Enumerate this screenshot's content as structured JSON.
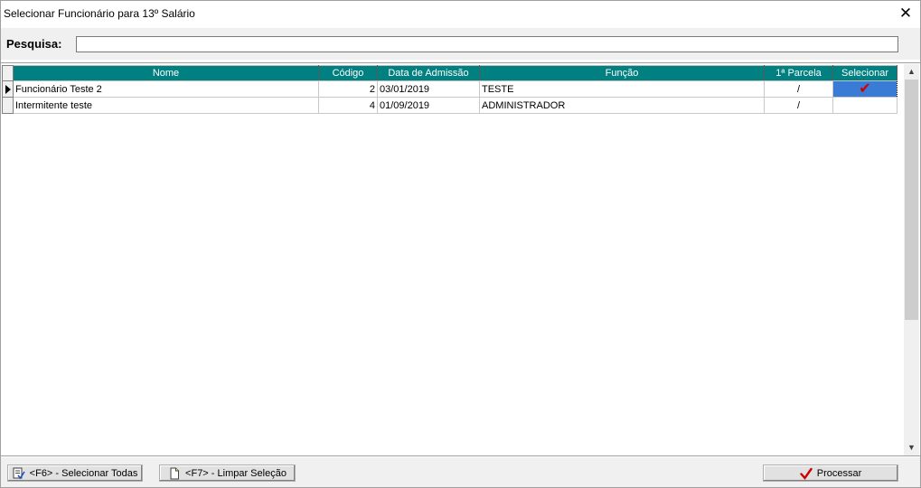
{
  "window": {
    "title": "Selecionar Funcionário para 13º Salário",
    "close_glyph": "✕"
  },
  "search": {
    "label": "Pesquisa:",
    "value": "",
    "placeholder": ""
  },
  "grid": {
    "columns": [
      "Nome",
      "Código",
      "Data de Admissão",
      "Função",
      "1ª Parcela",
      "Selecionar"
    ],
    "rows": [
      {
        "nome": "Funcionário Teste 2",
        "codigo": "2",
        "data_admissao": "03/01/2019",
        "funcao": "TESTE",
        "parcela": "/",
        "selecionar": "✔",
        "current": true,
        "selected": true
      },
      {
        "nome": "Intermitente teste",
        "codigo": "4",
        "data_admissao": "01/09/2019",
        "funcao": "ADMINISTRADOR",
        "parcela": "/",
        "selecionar": "",
        "current": false,
        "selected": false
      }
    ]
  },
  "scrollbar": {
    "up_glyph": "▲",
    "down_glyph": "▼"
  },
  "buttons": {
    "select_all": "<F6> - Selecionar Todas",
    "clear_selection": "<F7> - Limpar Seleção",
    "process": "Processar"
  },
  "colors": {
    "header_bg": "#008080",
    "selection_bg": "#3a7bd5",
    "check_color": "#d00000"
  },
  "icons": {
    "select_all": "checklist-icon",
    "clear_selection": "blank-page-icon",
    "process": "check-icon"
  }
}
